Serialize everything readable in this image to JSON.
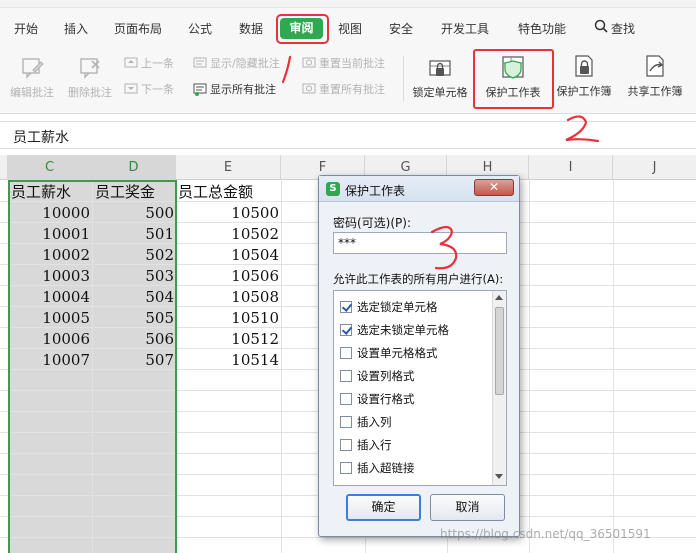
{
  "menu": {
    "tabs": [
      {
        "label": "开始"
      },
      {
        "label": "插入"
      },
      {
        "label": "页面布局"
      },
      {
        "label": "公式"
      },
      {
        "label": "数据"
      },
      {
        "label": "审阅"
      },
      {
        "label": "视图"
      },
      {
        "label": "安全"
      },
      {
        "label": "开发工具"
      },
      {
        "label": "特色功能"
      },
      {
        "label": "查找"
      }
    ]
  },
  "toolbar": {
    "edit_comment": "编辑批注",
    "delete_comment": "删除批注",
    "prev_comment": "上一条",
    "next_comment": "下一条",
    "show_hide_comment": "显示/隐藏批注",
    "show_all_comments": "显示所有批注",
    "reset_current_comment": "重置当前批注",
    "reset_all_comments": "重置所有批注",
    "lock_cell": "锁定单元格",
    "protect_sheet": "保护工作表",
    "protect_workbook": "保护工作簿",
    "share_workbook": "共享工作簿"
  },
  "formula_bar": {
    "content": "员工薪水"
  },
  "grid": {
    "columns": [
      "C",
      "D",
      "E",
      "F",
      "G",
      "H",
      "I",
      "J"
    ],
    "headers": [
      "员工薪水",
      "员工奖金",
      "员工总金额"
    ],
    "rows": [
      [
        "10000",
        "500",
        "10500"
      ],
      [
        "10001",
        "501",
        "10502"
      ],
      [
        "10002",
        "502",
        "10504"
      ],
      [
        "10003",
        "503",
        "10506"
      ],
      [
        "10004",
        "504",
        "10508"
      ],
      [
        "10005",
        "505",
        "10510"
      ],
      [
        "10006",
        "506",
        "10512"
      ],
      [
        "10007",
        "507",
        "10514"
      ]
    ]
  },
  "dialog": {
    "app_icon": "S",
    "title": "保护工作表",
    "close": "✕",
    "password_label": "密码(可选)(P):",
    "password_value": "***",
    "allow_label": "允许此工作表的所有用户进行(A):",
    "permissions": [
      {
        "label": "选定锁定单元格",
        "checked": true
      },
      {
        "label": "选定未锁定单元格",
        "checked": true
      },
      {
        "label": "设置单元格格式",
        "checked": false
      },
      {
        "label": "设置列格式",
        "checked": false
      },
      {
        "label": "设置行格式",
        "checked": false
      },
      {
        "label": "插入列",
        "checked": false
      },
      {
        "label": "插入行",
        "checked": false
      },
      {
        "label": "插入超链接",
        "checked": false
      }
    ],
    "ok": "确定",
    "cancel": "取消"
  },
  "watermark": "https://blog.csdn.net/qq_36501591",
  "colors": {
    "accent_green": "#2fa84f",
    "annotation_red": "#e8313a",
    "selection_green": "#3b9c4d"
  },
  "icons": [
    "search-icon",
    "edit-comment-icon",
    "delete-comment-icon",
    "lock-cell-icon",
    "protect-sheet-icon",
    "protect-workbook-icon",
    "share-workbook-icon",
    "checkbox-icon",
    "close-icon"
  ]
}
